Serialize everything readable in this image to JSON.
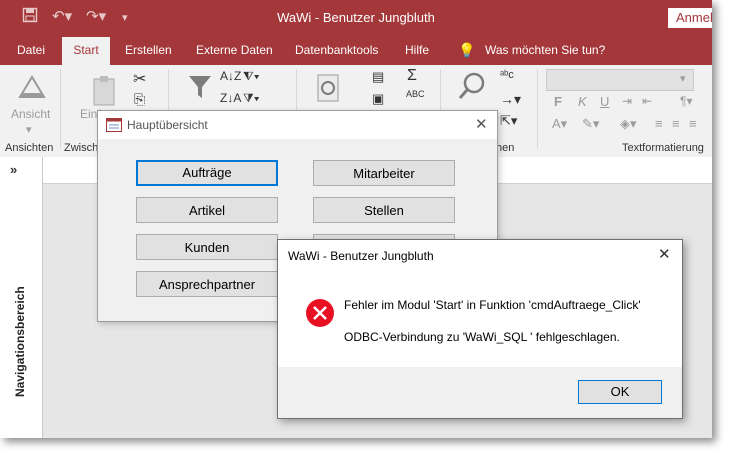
{
  "window": {
    "title": "WaWi - Benutzer Jungbluth",
    "signin_label": "Anmel",
    "accent": "#a4373a"
  },
  "tabs": [
    "Datei",
    "Start",
    "Erstellen",
    "Externe Daten",
    "Datenbanktools",
    "Hilfe"
  ],
  "tell_me": "Was möchten Sie tun?",
  "ribbon": {
    "view_label": "Ansicht",
    "paste_label": "Einf",
    "group_views": "Ansichten",
    "group_clipboard": "Zwisch",
    "group_find": "hen",
    "group_textformat": "Textformatierung",
    "font_buttons": [
      "F",
      "K",
      "U"
    ]
  },
  "nav_pane": {
    "toggle": "»",
    "label": "Navigationsbereich"
  },
  "main_form": {
    "title": "Hauptübersicht",
    "buttons": [
      "Aufträge",
      "Mitarbeiter",
      "Artikel",
      "Stellen",
      "Kunden",
      "Ansprechpartner"
    ]
  },
  "message_box": {
    "title": "WaWi - Benutzer Jungbluth",
    "line1": "Fehler im Modul 'Start' in Funktion 'cmdAuftraege_Click'",
    "line2": "ODBC-Verbindung zu 'WaWi_SQL ' fehlgeschlagen.",
    "ok_label": "OK",
    "error_color": "#e81123"
  }
}
